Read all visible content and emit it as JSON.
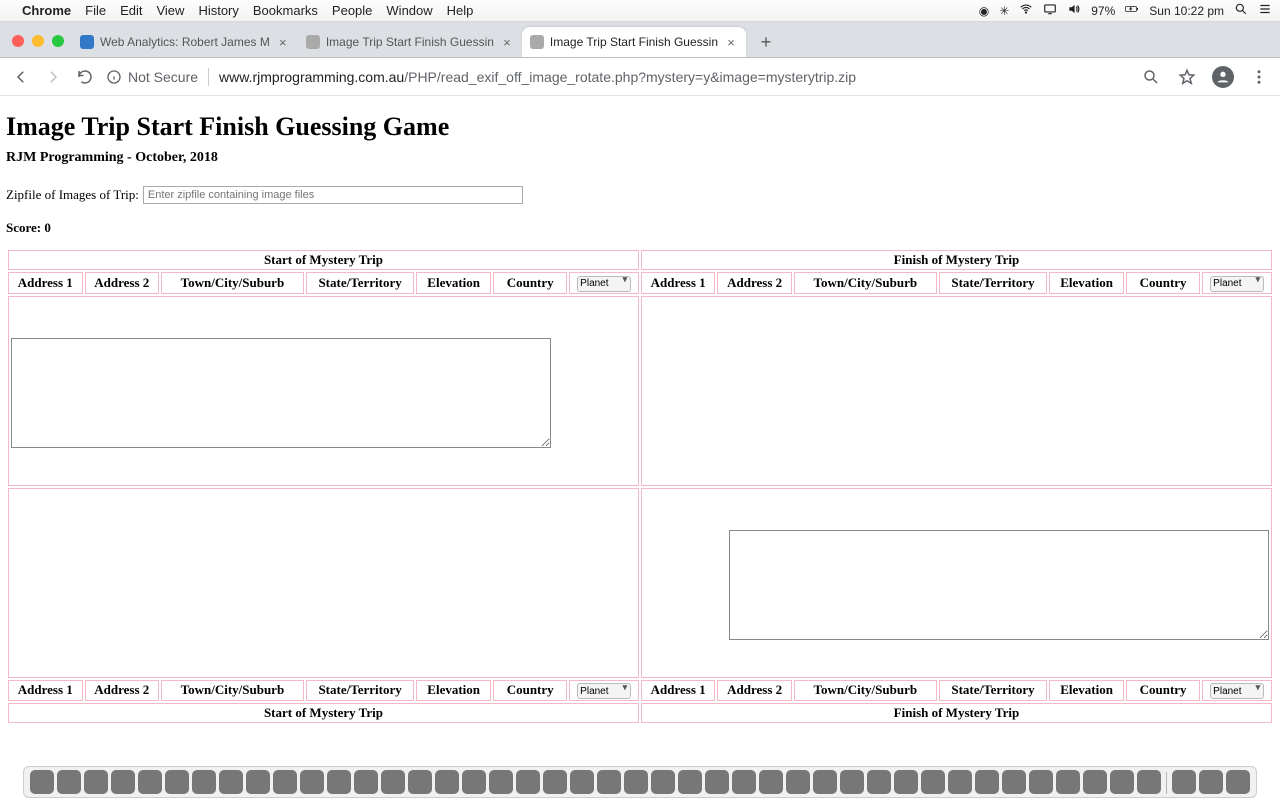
{
  "menubar": {
    "app": "Chrome",
    "items": [
      "File",
      "Edit",
      "View",
      "History",
      "Bookmarks",
      "People",
      "Window",
      "Help"
    ],
    "battery": "97%",
    "clock": "Sun 10:22 pm"
  },
  "tabs": [
    {
      "label": "Web Analytics: Robert James M",
      "active": false
    },
    {
      "label": "Image Trip Start Finish Guessin",
      "active": false
    },
    {
      "label": "Image Trip Start Finish Guessin",
      "active": true
    }
  ],
  "omnibox": {
    "not_secure": "Not Secure",
    "host": "www.rjmprogramming.com.au",
    "path": "/PHP/read_exif_off_image_rotate.php?mystery=y&image=mysterytrip.zip"
  },
  "page": {
    "title": "Image Trip Start Finish Guessing Game",
    "subtitle": "RJM Programming - October, 2018",
    "zip_label": "Zipfile of Images of Trip:",
    "zip_placeholder": "Enter zipfile containing image files",
    "score_label": "Score: 0",
    "headers": {
      "start": "Start of Mystery Trip",
      "finish": "Finish of Mystery Trip",
      "cols": [
        "Address 1",
        "Address 2",
        "Town/City/Suburb",
        "State/Territory",
        "Elevation",
        "Country"
      ],
      "planet": "Planet"
    }
  }
}
